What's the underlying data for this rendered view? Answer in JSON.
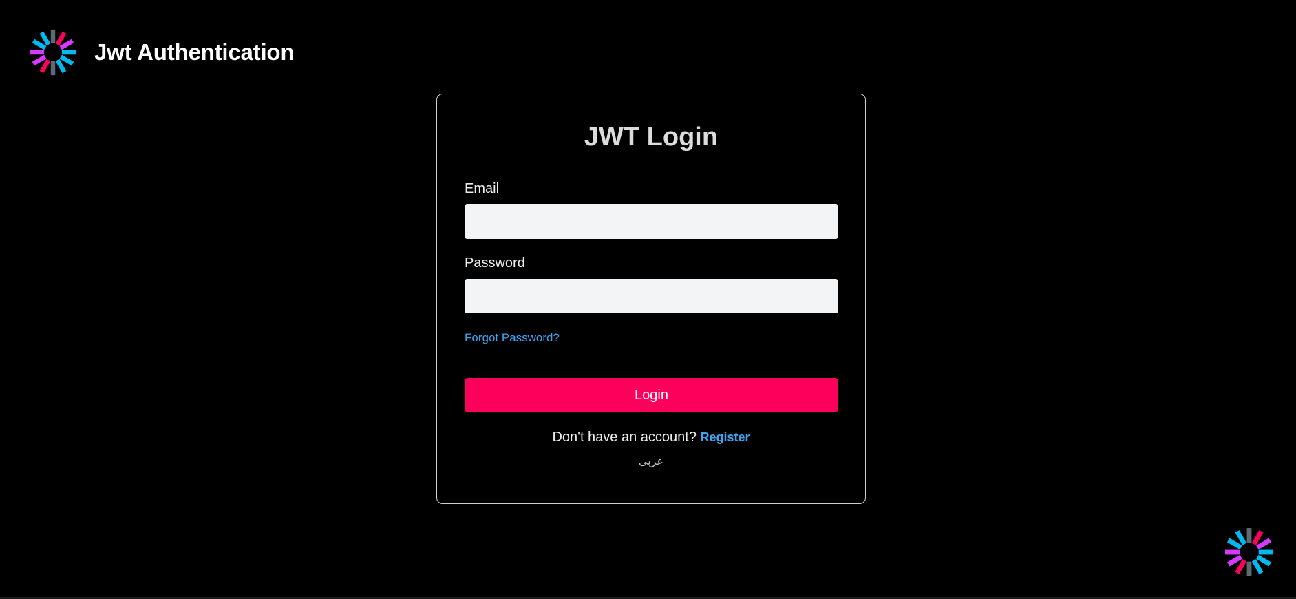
{
  "brand": {
    "title": "Jwt Authentication",
    "logo_icon": "jwt-logo-icon"
  },
  "login_card": {
    "title": "JWT Login",
    "email": {
      "label": "Email",
      "value": "",
      "placeholder": ""
    },
    "password": {
      "label": "Password",
      "value": "",
      "placeholder": ""
    },
    "forgot_password_label": "Forgot Password?",
    "login_button_label": "Login",
    "register_prompt": "Don't have an account?",
    "register_link_label": "Register",
    "language_toggle_label": "عربي"
  },
  "corner_logo_icon": "jwt-logo-icon",
  "colors": {
    "background": "#000000",
    "accent": "#fb015b",
    "link": "#3aa6f2",
    "input_background": "#f3f4f6",
    "card_border": "#cfcfcf",
    "logo_cyan": "#00b9f1",
    "logo_magenta": "#d63aff",
    "logo_pink": "#fb015b",
    "logo_slate": "#5c6a73"
  }
}
